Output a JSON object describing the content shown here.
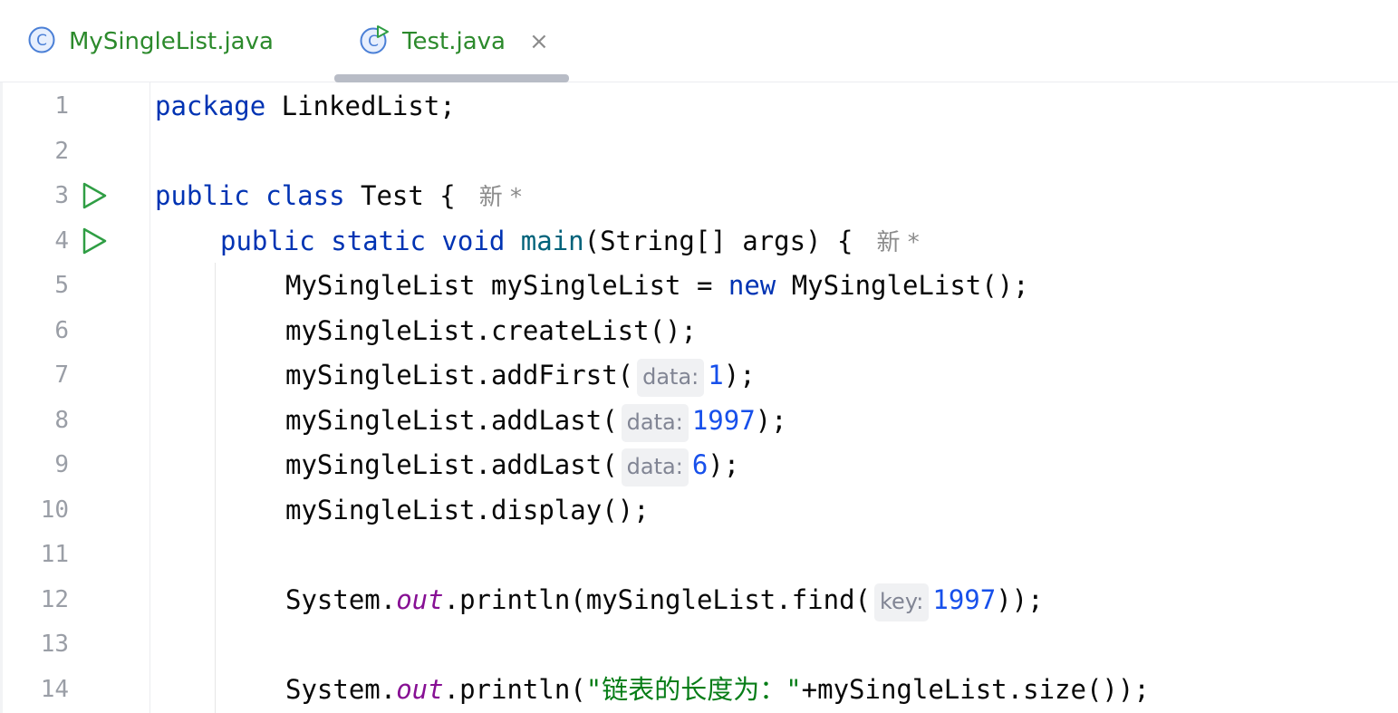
{
  "tabs": [
    {
      "label": "MySingleList.java",
      "icon": "class-icon",
      "active": false
    },
    {
      "label": "Test.java",
      "icon": "class-runnable-icon",
      "active": true,
      "close": "×"
    }
  ],
  "colors": {
    "tab_text": "#2c8a2c",
    "keyword": "#0033b3",
    "method_decl": "#00627a",
    "number": "#1750eb",
    "field": "#871094",
    "string": "#067d17",
    "run_icon": "#2f9e44"
  },
  "gutter": {
    "line_numbers": [
      "1",
      "2",
      "3",
      "4",
      "5",
      "6",
      "7",
      "8",
      "9",
      "10",
      "11",
      "12",
      "13",
      "14"
    ],
    "run_markers_on_lines": [
      3,
      4
    ]
  },
  "code": {
    "l1": {
      "kw": "package",
      "rest": " LinkedList;"
    },
    "l3": {
      "kw1": "public",
      "kw2": "class",
      "rest": " Test {",
      "author": "新 *"
    },
    "l4": {
      "kw1": "public",
      "kw2": "static",
      "kw3": "void",
      "fn": "main",
      "rest": "(String[] args) {",
      "author": "新 *"
    },
    "l5": {
      "pre": "MySingleList mySingleList = ",
      "kw": "new",
      "post": " MySingleList();"
    },
    "l6": {
      "text": "mySingleList.createList();"
    },
    "l7": {
      "pre": "mySingleList.addFirst(",
      "hint": "data:",
      "num": "1",
      "post": ");"
    },
    "l8": {
      "pre": "mySingleList.addLast(",
      "hint": "data:",
      "num": "1997",
      "post": ");"
    },
    "l9": {
      "pre": "mySingleList.addLast(",
      "hint": "data:",
      "num": "6",
      "post": ");"
    },
    "l10": {
      "text": "mySingleList.display();"
    },
    "l12": {
      "pre": "System.",
      "field": "out",
      "mid": ".println(mySingleList.find(",
      "hint": "key:",
      "num": "1997",
      "post": "));"
    },
    "l14": {
      "pre": "System.",
      "field": "out",
      "mid": ".println(",
      "str": "\"链表的长度为：\"",
      "post": "+mySingleList.size());"
    }
  }
}
